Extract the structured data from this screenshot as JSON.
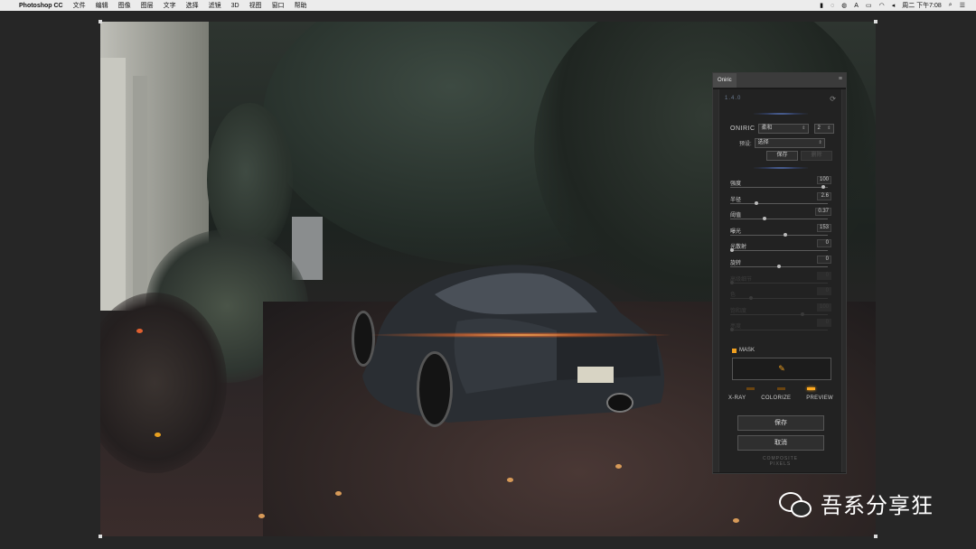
{
  "menubar": {
    "apple_icon": "",
    "app_name": "Photoshop CC",
    "items": [
      "文件",
      "编辑",
      "图像",
      "图层",
      "文字",
      "选择",
      "滤镜",
      "3D",
      "视图",
      "窗口",
      "帮助"
    ],
    "status": {
      "input_method": "A",
      "datetime": "周二 下午7:08"
    }
  },
  "panel": {
    "tab": "Oniric",
    "version": "1.4.0",
    "oniric_label": "ONIRIC",
    "mode_select": "柔和",
    "count_select": "2",
    "preset_label": "预设:",
    "preset_select": "选择",
    "save_small": "保存",
    "delete_small": "删除",
    "sliders": [
      {
        "label": "强度",
        "value": "100",
        "pos": 0.97,
        "enabled": true
      },
      {
        "label": "半径",
        "value": "2.6",
        "pos": 0.26,
        "enabled": true
      },
      {
        "label": "阈值",
        "value": "0.37",
        "pos": 0.35,
        "enabled": true
      },
      {
        "label": "曝光",
        "value": "153",
        "pos": 0.57,
        "enabled": true
      },
      {
        "label": "光散射",
        "value": "0",
        "pos": 0.0,
        "enabled": true
      },
      {
        "label": "旋转",
        "value": "0",
        "pos": 0.5,
        "enabled": true
      },
      {
        "label": "高级细节",
        "value": "0",
        "pos": 0.0,
        "enabled": false
      },
      {
        "label": "色",
        "value": "0",
        "pos": 0.2,
        "enabled": false
      },
      {
        "label": "饱和度",
        "value": "100",
        "pos": 0.75,
        "enabled": false
      },
      {
        "label": "亮度",
        "value": "0",
        "pos": 0.0,
        "enabled": false
      }
    ],
    "mask_label": "MASK",
    "modes": [
      "X-RAY",
      "COLORIZE",
      "PREVIEW"
    ],
    "save_button": "保存",
    "cancel_button": "取消",
    "footer_line1": "COMPOSITE",
    "footer_line2": "PIXELS"
  },
  "watermark": {
    "text": "吾系分享狂"
  }
}
